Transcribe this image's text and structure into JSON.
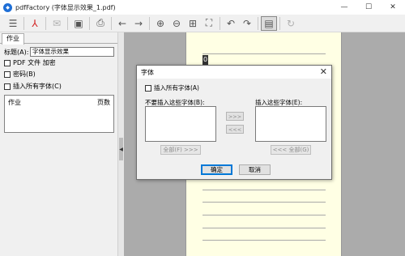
{
  "window": {
    "title": "pdfFactory (字体显示效果_1.pdf)",
    "app_icon": "pdffactory-icon",
    "controls": {
      "minimize": "—",
      "maximize": "☐",
      "close": "✕"
    }
  },
  "toolbar": {
    "icons": [
      "menu-icon",
      "pdf-icon",
      "email-icon",
      "save-icon",
      "print-icon",
      "back-arrow-icon",
      "forward-arrow-icon",
      "zoom-in-icon",
      "zoom-out-icon",
      "fit-width-icon",
      "fit-page-icon",
      "undo-icon",
      "redo-icon",
      "document-view-icon",
      "refresh-icon"
    ]
  },
  "left_panel": {
    "tab": "作业",
    "title_label": "标题(A):",
    "title_value": "字体显示效果",
    "pdfa_label": "PDF 文件 加密",
    "password_label": "密码(B)",
    "embed_fonts_label": "插入所有字体(C)",
    "list_col_job": "作业",
    "list_col_pages": "页数",
    "splitter_arrow": "◀"
  },
  "preview": {
    "cursor_char": "0",
    "page_color": "#ffffe4"
  },
  "dialog": {
    "title": "字体",
    "close_glyph": "✕",
    "embed_all_label": "插入所有字体(A)",
    "not_embed_label": "不要插入这些字体(B):",
    "embed_label": "插入这些字体(E):",
    "move_right": ">>>",
    "move_left": "<<<",
    "all_right": "全部(F) >>>",
    "all_left": "<<< 全部(G)",
    "ok": "确定",
    "cancel": "取消"
  }
}
